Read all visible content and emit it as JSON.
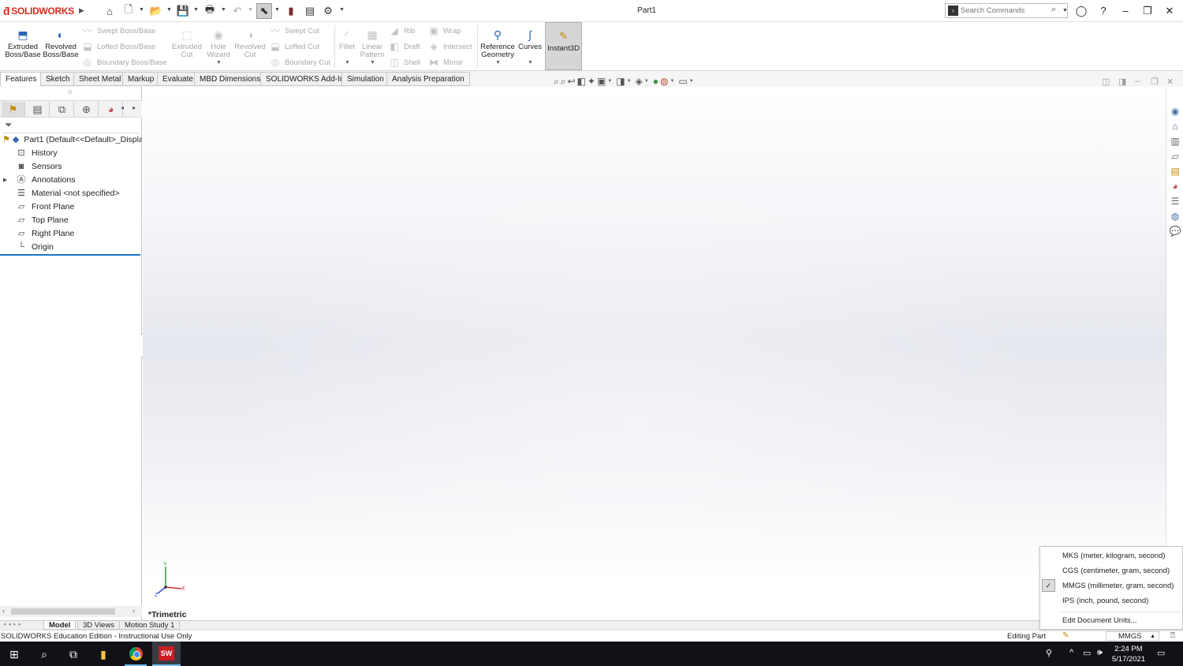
{
  "app": {
    "brand": "SOLIDWORKS",
    "document_title": "Part1"
  },
  "search": {
    "placeholder": "Search Commands"
  },
  "ribbon": {
    "extruded_boss": "Extruded Boss/Base",
    "revolved_boss": "Revolved Boss/Base",
    "swept_boss": "Swept Boss/Base",
    "lofted_boss": "Lofted Boss/Base",
    "boundary_boss": "Boundary Boss/Base",
    "extruded_cut": "Extruded Cut",
    "hole_wizard": "Hole Wizard",
    "revolved_cut": "Revolved Cut",
    "swept_cut": "Swept Cut",
    "lofted_cut": "Lofted Cut",
    "boundary_cut": "Boundary Cut",
    "fillet": "Fillet",
    "linear_pattern": "Linear Pattern",
    "rib": "Rib",
    "draft": "Draft",
    "shell": "Shell",
    "wrap": "Wrap",
    "intersect": "Intersect",
    "mirror": "Mirror",
    "reference_geometry": "Reference Geometry",
    "curves": "Curves",
    "instant3d": "Instant3D"
  },
  "command_tabs": [
    "Features",
    "Sketch",
    "Sheet Metal",
    "Markup",
    "Evaluate",
    "MBD Dimensions",
    "SOLIDWORKS Add-Ins",
    "Simulation",
    "Analysis Preparation"
  ],
  "tree": {
    "root": "Part1  (Default<<Default>_Display",
    "items": [
      "History",
      "Sensors",
      "Annotations",
      "Material <not specified>",
      "Front Plane",
      "Top Plane",
      "Right Plane",
      "Origin"
    ]
  },
  "viewport": {
    "view_label": "*Trimetric",
    "triad_x": "X",
    "triad_y": "Y",
    "triad_z": "Z"
  },
  "bottom_tabs": [
    "Model",
    "3D Views",
    "Motion Study 1"
  ],
  "status": {
    "left": "SOLIDWORKS Education Edition - Instructional Use Only",
    "editing": "Editing Part",
    "units": "MMGS"
  },
  "units_menu": {
    "items": [
      "MKS (meter, kilogram, second)",
      "CGS (centimeter, gram, second)",
      "MMGS (millimeter, gram, second)",
      "IPS (inch, pound, second)"
    ],
    "selected": "MMGS (millimeter, gram, second)",
    "edit": "Edit Document Units..."
  },
  "taskbar": {
    "time": "2:24 PM",
    "date": "5/17/2021"
  },
  "colors": {
    "brand_red": "#d52b1e",
    "selection_blue": "#1f73c9",
    "taskbar": "#101218"
  }
}
